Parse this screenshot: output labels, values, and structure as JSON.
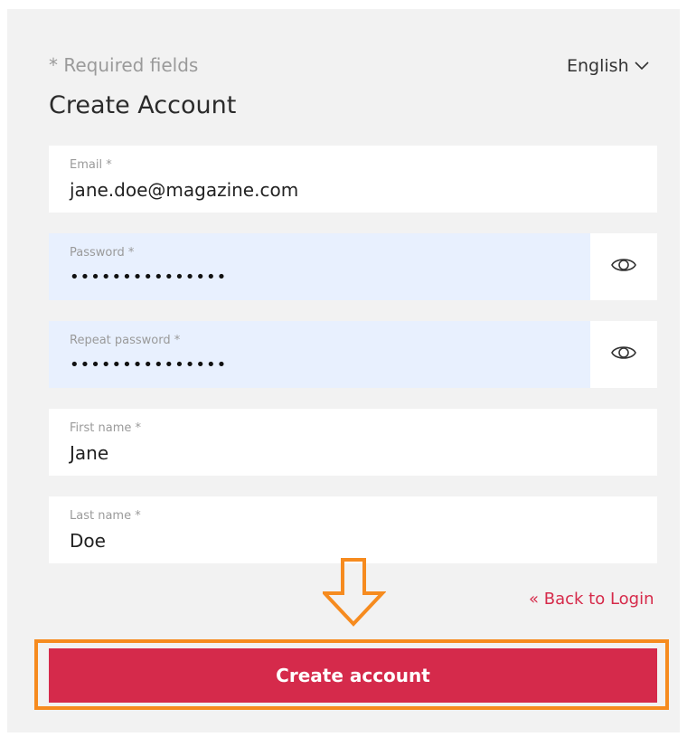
{
  "form": {
    "required_note": "* Required fields",
    "language": "English",
    "title": "Create Account",
    "fields": [
      {
        "label": "Email *",
        "value": "jane.doe@magazine.com"
      },
      {
        "label": "Password *",
        "value": "•••••••••••••••"
      },
      {
        "label": "Repeat password *",
        "value": "•••••••••••••••"
      },
      {
        "label": "First name *",
        "value": "Jane"
      },
      {
        "label": "Last name *",
        "value": "Doe"
      }
    ],
    "back_link": "« Back to Login",
    "submit_label": "Create account"
  },
  "colors": {
    "accent": "#d52a4b",
    "highlight": "#f68b1f",
    "autofill_bg": "#e8f0fe",
    "panel_bg": "#f2f2f2"
  },
  "icons": [
    "chevron-down-icon",
    "eye-icon",
    "arrow-down-icon"
  ]
}
